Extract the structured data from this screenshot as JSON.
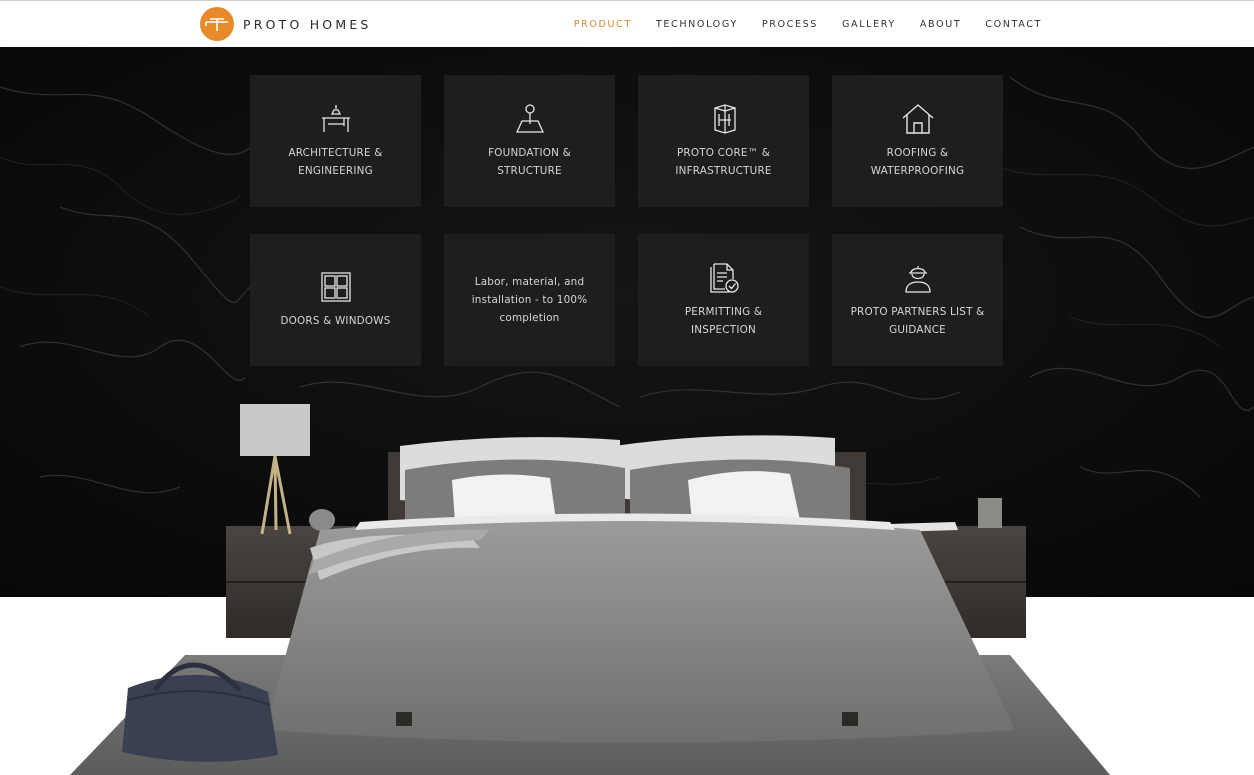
{
  "header": {
    "brand": "PROTO HOMES",
    "nav": [
      {
        "label": "PRODUCT",
        "active": true
      },
      {
        "label": "TECHNOLOGY",
        "active": false
      },
      {
        "label": "PROCESS",
        "active": false
      },
      {
        "label": "GALLERY",
        "active": false
      },
      {
        "label": "ABOUT",
        "active": false
      },
      {
        "label": "CONTACT",
        "active": false
      }
    ]
  },
  "tiles": [
    {
      "label": "ARCHITECTURE & ENGINEERING",
      "icon": "drafting-table-icon"
    },
    {
      "label": "FOUNDATION & STRUCTURE",
      "icon": "foundation-pin-icon"
    },
    {
      "label": "PROTO CORE™ & INFRASTRUCTURE",
      "icon": "core-module-icon"
    },
    {
      "label": "ROOFING & WATERPROOFING",
      "icon": "house-roof-icon"
    },
    {
      "label": "DOORS & WINDOWS",
      "icon": "window-icon"
    },
    {
      "label": "Labor, material, and installation - to 100% completion",
      "icon": ""
    },
    {
      "label": "PERMITTING & INSPECTION",
      "icon": "document-check-icon"
    },
    {
      "label": "PROTO PARTNERS LIST & GUIDANCE",
      "icon": "worker-hardhat-icon"
    }
  ],
  "colors": {
    "accent": "#e8892a",
    "nav_active": "#d98a2f",
    "hero_bg": "#0d0d0d",
    "tile_bg": "#1e1e1e",
    "tile_text": "#d6d6d6"
  }
}
